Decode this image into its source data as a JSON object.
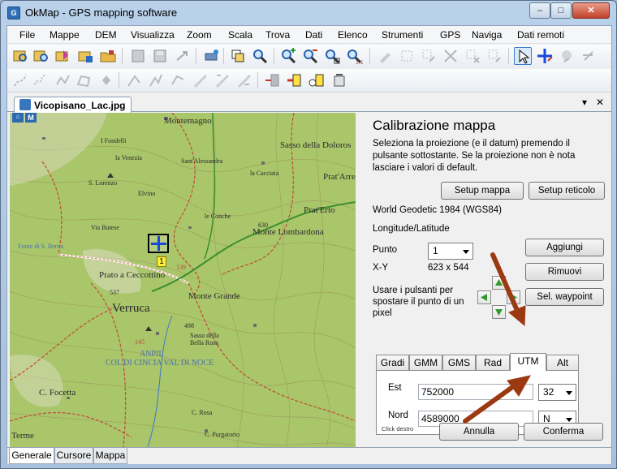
{
  "window": {
    "title": "OkMap - GPS mapping software",
    "min_glyph": "–",
    "max_glyph": "□",
    "close_glyph": "✕"
  },
  "menu": [
    "File",
    "Mappe",
    "DEM",
    "Visualizza",
    "Zoom",
    "Scala",
    "Trova",
    "Dati",
    "Elenco",
    "Strumenti",
    "GPS",
    "Naviga",
    "Dati remoti"
  ],
  "document": {
    "tab_label": "Vicopisano_Lac.jpg",
    "dropdown_glyph": "▾",
    "close_glyph": "✕"
  },
  "map": {
    "home_label": "⌂",
    "m_label": "M",
    "point_badge": "1",
    "labels": {
      "montemagno": "Montemagno",
      "sasso_doloros": "Sasso della Doloros",
      "santalessandra": "Sant'Alessandra",
      "la_cacciaia": "la Cacciaia",
      "pratarre": "Prat'Arre",
      "pratero": "Prat'Erto",
      "le_conche": "le Conche",
      "monte_lombardona": "Monte Lombardona",
      "prato_cecottino": "Prato a Ceccottino",
      "monte_grande": "Monte Grande",
      "verruca": "Verruca",
      "sasso_bella_rosa": "Sasso della\nBella Rosa",
      "col_di_cincia": "COL DI CINCIA  VAL DI NOCE",
      "anpil": "ANPIL",
      "c_focetta": "C. Focetta",
      "c_rosa": "C. Rosa",
      "c_purgatorio": "C. Purgatorio",
      "terme": "Terme",
      "la_venezia": "la Venezia",
      "fondelli": "I Fondelli",
      "s_lorenzo": "S. Lorenzo",
      "elvino": "Elvino",
      "via_butese": "Via Butese",
      "fonte_sberna": "Fonte di S. Berna",
      "elev_537": "537",
      "elev_630": "630",
      "elev_498": "498",
      "elev_145": "145",
      "elev_139": "139"
    }
  },
  "panel": {
    "title": "Calibrazione mappa",
    "description": "Seleziona la proiezione (e il datum) premendo il pulsante sottostante. Se la proiezione non è nota lasciare i valori di default.",
    "setup_map_button": "Setup mappa",
    "setup_grid_button": "Setup reticolo",
    "datum": "World Geodetic 1984 (WGS84)",
    "projection": "Longitude/Latitude",
    "point_label": "Punto",
    "point_value": "1",
    "xy_label": "X-Y",
    "xy_value": "623 x 544",
    "add_button": "Aggiungi",
    "remove_button": "Rimuovi",
    "waypoint_button": "Sel. waypoint",
    "move_hint": "Usare i pulsanti per spostare il punto di un pixel",
    "coord_tabs": [
      "Gradi",
      "GMM",
      "GMS",
      "Rad",
      "UTM",
      "Alt"
    ],
    "active_tab": "UTM",
    "est_label": "Est",
    "est_value": "752000",
    "zone_value": "32",
    "nord_label": "Nord",
    "nord_value": "4589000",
    "hemisphere_value": "N",
    "right_click_hint": "Click destro",
    "cancel_button": "Annulla",
    "confirm_button": "Conferma"
  },
  "bottom_tabs": [
    "Generale",
    "Cursore",
    "Mappa"
  ],
  "colors": {
    "annotation_arrow": "#9b3a12",
    "map_green": "#a8c56a",
    "arrow_green": "#2e9b2e"
  }
}
